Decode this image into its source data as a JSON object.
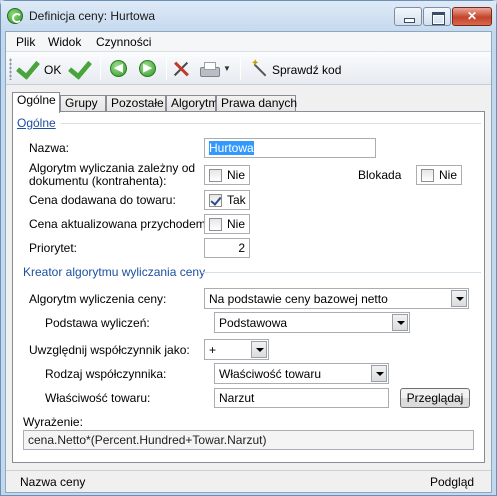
{
  "window": {
    "title": "Definicja ceny: Hurtowa"
  },
  "menu": {
    "items": [
      "Plik",
      "Widok",
      "Czynności"
    ]
  },
  "toolbar": {
    "ok_label": "OK",
    "check_code_label": "Sprawdź kod"
  },
  "tabs": [
    "Ogólne",
    "Grupy",
    "Pozostałe",
    "Algorytm",
    "Prawa danych"
  ],
  "general": {
    "group_title": "Ogólne",
    "name_label": "Nazwa:",
    "name_value": "Hurtowa",
    "algorithm_dependent_label_1": "Algorytm wyliczania zależny od",
    "algorithm_dependent_label_2": "dokumentu (kontrahenta):",
    "algorithm_dependent_value": "Nie",
    "block_label": "Blokada",
    "block_value": "Nie",
    "price_added_label": "Cena dodawana do towaru:",
    "price_added_value": "Tak",
    "price_updated_label": "Cena aktualizowana przychodem:",
    "price_updated_value": "Nie",
    "priority_label": "Priorytet:",
    "priority_value": "2"
  },
  "wizard": {
    "group_title": "Kreator algorytmu wyliczania ceny",
    "algorithm_label": "Algorytm wyliczenia ceny:",
    "algorithm_value": "Na podstawie ceny bazowej netto",
    "basis_label": "Podstawa wyliczeń:",
    "basis_value": "Podstawowa",
    "coefficient_label": "Uwzględnij współczynnik jako:",
    "coefficient_value": "+",
    "coefficient_type_label": "Rodzaj współczynnika:",
    "coefficient_type_value": "Właściwość towaru",
    "product_property_label": "Właściwość towaru:",
    "product_property_value": "Narzut",
    "browse_button": "Przeglądaj",
    "expression_label": "Wyrażenie:",
    "expression_value": "cena.Netto*(Percent.Hundred+Towar.Narzut)"
  },
  "status": {
    "left": "Nazwa ceny",
    "right": "Podgląd"
  }
}
